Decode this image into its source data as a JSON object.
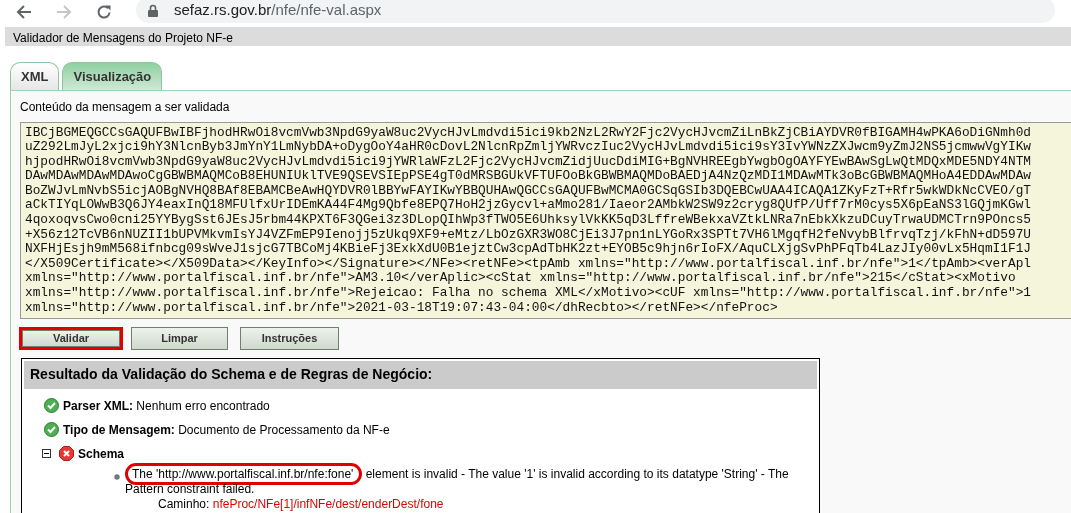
{
  "browser": {
    "url_host": "sefaz.rs.gov.br",
    "url_path": "/nfe/nfe-val.aspx",
    "forward_disabled": true
  },
  "header": {
    "title": "Validador de Mensagens do Projeto NF-e"
  },
  "tabs": [
    {
      "label": "XML",
      "selected": true
    },
    {
      "label": "Visualização",
      "selected": false
    }
  ],
  "message": {
    "label": "Conteúdo da mensagem a ser validada",
    "lines": [
      "IBCjBGMEQGCCsGAQUFBwIBFjhodHRwOi8vcmVwb3NpdG9yaW8uc2VycHJvLmdvdi5ici9kb2NzL2RwY2Fjc2VycHJvcmZiLnBkZjCBiAYDVR0fBIGAMH4wPKA6oDiGNmh0d",
      "uZ292LmJyL2xjci9hY3NlcnByb3JmYnY1LmNybDA+oDygOoY4aHR0cDovL2NlcnRpZmljYWRvczIuc2VycHJvLmdvdi5ici9sY3IvYWNzZXJwcm9yZmJ2NS5jcmwwVgYIKw",
      "hjpodHRwOi8vcmVwb3NpdG9yaW8uc2VycHJvLmdvdi5ici9jYWRlaWFzL2Fjc2VycHJvcmZidjUucDdiMIG+BgNVHREEgbYwgbOgOAYFYEwBAwSgLwQtMDQxMDE5NDY4NTM",
      "DAwMDAwMDAwMDAwoCgGBWBMAQMCoB8EHUNIUklTVE9QSEVSIEpPSE4gT0dMRSBGUkVFTUFOoBkGBWBMAQMDoBAEDjA4NzQzMDI1MDAwMTk3oBcGBWBMAQMHoA4EDDAwMDAw",
      "BoZWJvLmNvbS5icjAOBgNVHQ8BAf8EBAMCBeAwHQYDVR0lBBYwFAYIKwYBBQUHAwQGCCsGAQUFBwMCMA0GCSqGSIb3DQEBCwUAA4ICAQA1ZKyFzT+Rfr5wkWDkNcCVEO/gT",
      "aCkTIYqLOWwB3Q6JY4eaxInQ18MFUlfxUrIDEmKA44F4Mg9Qbfe8EPQ7HoH2jzGycvl+aMmo281/Iaeor2AMbkW2SW9z2cryg8QUfP/Uff7rM0cys5X6pEaNS3lGQjmKGwl",
      "4qoxoqvsCwo0cni25YYBygSst6JEsJ5rbm44KPXT6F3QGei3z3DLopQIhWp3fTWO5E6UhksylVkKK5qD3LffreWBekxaVZtkLNRa7nEbkXkzuDCuyTrwaUDMCTrn9POncs5",
      "+X56z12TcVB6nNUZII1bUPVMkvmIsYJ4VZFmEP9Ienojj5zUkq9XF9+eMtz/LbOzGXR3WO8CjEi3J7pn1nLYGoRx3SPTt7VH6lMgqfH2feNvybBlfrvqTzj/kFhN+dD597U",
      "NXFHjEsjh9mM568ifnbcg09sWveJ1sjcG7TBCoMj4KBieFj3ExkXdU0B1ejztCw3cpAdTbHK2zt+EYOB5c9hjn6rIoFX/AquCLXjgSvPhPFqTb4LazJIy00vLx5HqmI1F1J",
      "</X509Certificate></X509Data></KeyInfo></Signature></NFe><retNFe><tpAmb xmlns=\"http://www.portalfiscal.inf.br/nfe\">1</tpAmb><verApl",
      "xmlns=\"http://www.portalfiscal.inf.br/nfe\">AM3.10</verAplic><cStat xmlns=\"http://www.portalfiscal.inf.br/nfe\">215</cStat><xMotivo",
      "xmlns=\"http://www.portalfiscal.inf.br/nfe\">Rejeicao: Falha no schema XML</xMotivo><cUF xmlns=\"http://www.portalfiscal.inf.br/nfe\">1",
      "xmlns=\"http://www.portalfiscal.inf.br/nfe\">2021-03-18T19:07:43-04:00</dhRecbto></retNFe></nfeProc>"
    ]
  },
  "buttons": [
    {
      "label": "Validar",
      "highlighted": true
    },
    {
      "label": "Limpar",
      "highlighted": false
    },
    {
      "label": "Instruções",
      "highlighted": false
    }
  ],
  "result": {
    "title": "Resultado da Validação do Schema e de Regras de Negócio:",
    "items": [
      {
        "kind": "ok",
        "label": "Parser XML:",
        "text": "Nenhum erro encontrado"
      },
      {
        "kind": "ok",
        "label": "Tipo de Mensagem:",
        "text": "Documento de Processamento da NF-e"
      },
      {
        "kind": "error",
        "label": "Schema",
        "expanded": true,
        "errors": [
          {
            "highlight": "The 'http://www.portalfiscal.inf.br/nfe:fone'",
            "text": "element is invalid - The value '1' is invalid according to its datatype 'String' - The Pattern constraint failed.",
            "path_label": "Caminho:",
            "path": "nfeProc/NFe[1]/infNFe/dest/enderDest/fone"
          }
        ]
      }
    ]
  }
}
